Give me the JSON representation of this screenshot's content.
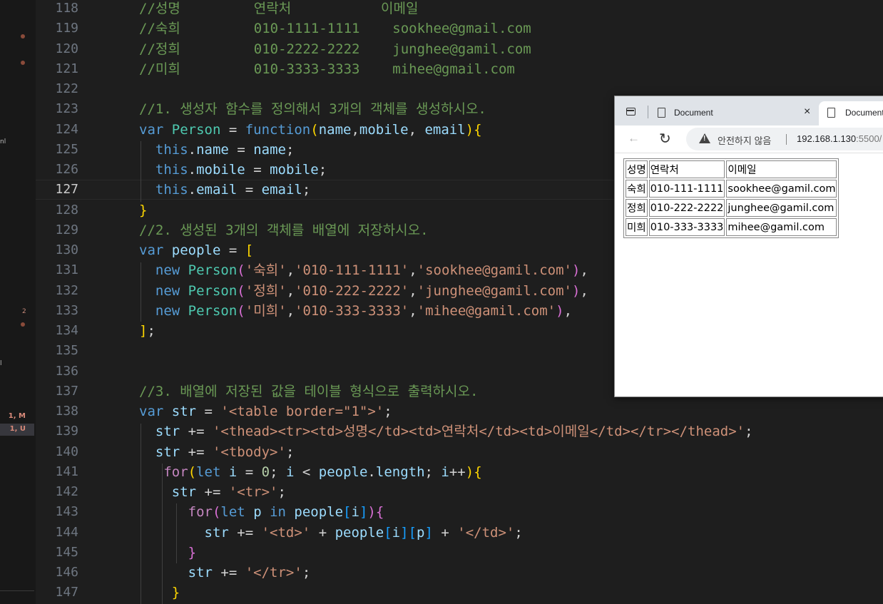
{
  "sidebar": {
    "badges": [
      {
        "label": "2"
      },
      {
        "label": "1, M"
      },
      {
        "label": "1, U"
      },
      {
        "label": "nl"
      },
      {
        "label": "l"
      }
    ]
  },
  "editor": {
    "lines": [
      {
        "n": "118",
        "tokens": [
          [
            "c-com",
            "//성명         연락처           이메일"
          ]
        ]
      },
      {
        "n": "119",
        "tokens": [
          [
            "c-com",
            "//숙희         010-1111-1111    sookhee@gmail.com"
          ]
        ]
      },
      {
        "n": "120",
        "tokens": [
          [
            "c-com",
            "//정희         010-2222-2222    junghee@gamil.com"
          ]
        ]
      },
      {
        "n": "121",
        "tokens": [
          [
            "c-com",
            "//미희         010-3333-3333    mihee@gmail.com"
          ]
        ]
      },
      {
        "n": "122",
        "tokens": []
      },
      {
        "n": "123",
        "tokens": [
          [
            "c-com",
            "//1. 생성자 함수를 정의해서 3개의 객체를 생성하시오."
          ]
        ]
      },
      {
        "n": "124",
        "tokens": [
          [
            "c-kw",
            "var "
          ],
          [
            "c-cls",
            "Person"
          ],
          [
            "",
            " = "
          ],
          [
            "c-kw",
            "function"
          ],
          [
            "c-p1",
            "("
          ],
          [
            "c-var",
            "name"
          ],
          [
            "",
            ","
          ],
          [
            "c-var",
            "mobile"
          ],
          [
            "",
            ", "
          ],
          [
            "c-var",
            "email"
          ],
          [
            "c-p1",
            ")"
          ],
          [
            "c-p1",
            "{"
          ]
        ]
      },
      {
        "n": "125",
        "tokens": [
          [
            "",
            "  "
          ],
          [
            "c-kw",
            "this"
          ],
          [
            "",
            "."
          ],
          [
            "c-var",
            "name"
          ],
          [
            "",
            " = "
          ],
          [
            "c-var",
            "name"
          ],
          [
            "",
            ";"
          ]
        ]
      },
      {
        "n": "126",
        "tokens": [
          [
            "",
            "  "
          ],
          [
            "c-kw",
            "this"
          ],
          [
            "",
            "."
          ],
          [
            "c-var",
            "mobile"
          ],
          [
            "",
            " = "
          ],
          [
            "c-var",
            "mobile"
          ],
          [
            "",
            ";"
          ]
        ]
      },
      {
        "n": "127",
        "tokens": [
          [
            "",
            "  "
          ],
          [
            "c-kw",
            "this"
          ],
          [
            "",
            "."
          ],
          [
            "c-var",
            "email"
          ],
          [
            "",
            " = "
          ],
          [
            "c-var",
            "email"
          ],
          [
            "",
            ";"
          ]
        ]
      },
      {
        "n": "128",
        "tokens": [
          [
            "c-p1",
            "}"
          ]
        ]
      },
      {
        "n": "129",
        "tokens": [
          [
            "c-com",
            "//2. 생성된 3개의 객체를 배열에 저장하시오."
          ]
        ]
      },
      {
        "n": "130",
        "tokens": [
          [
            "c-kw",
            "var "
          ],
          [
            "c-var",
            "people"
          ],
          [
            "",
            " = "
          ],
          [
            "c-p1",
            "["
          ]
        ]
      },
      {
        "n": "131",
        "tokens": [
          [
            "",
            "  "
          ],
          [
            "c-kw",
            "new "
          ],
          [
            "c-cls",
            "Person"
          ],
          [
            "c-p2",
            "("
          ],
          [
            "c-str",
            "'숙희'"
          ],
          [
            "",
            ","
          ],
          [
            "c-str",
            "'010-111-1111'"
          ],
          [
            "",
            ","
          ],
          [
            "c-str",
            "'sookhee@gamil.com'"
          ],
          [
            "c-p2",
            ")"
          ],
          [
            "",
            ","
          ]
        ]
      },
      {
        "n": "132",
        "tokens": [
          [
            "",
            "  "
          ],
          [
            "c-kw",
            "new "
          ],
          [
            "c-cls",
            "Person"
          ],
          [
            "c-p2",
            "("
          ],
          [
            "c-str",
            "'정희'"
          ],
          [
            "",
            ","
          ],
          [
            "c-str",
            "'010-222-2222'"
          ],
          [
            "",
            ","
          ],
          [
            "c-str",
            "'junghee@gamil.com'"
          ],
          [
            "c-p2",
            ")"
          ],
          [
            "",
            ","
          ]
        ]
      },
      {
        "n": "133",
        "tokens": [
          [
            "",
            "  "
          ],
          [
            "c-kw",
            "new "
          ],
          [
            "c-cls",
            "Person"
          ],
          [
            "c-p2",
            "("
          ],
          [
            "c-str",
            "'미희'"
          ],
          [
            "",
            ","
          ],
          [
            "c-str",
            "'010-333-3333'"
          ],
          [
            "",
            ","
          ],
          [
            "c-str",
            "'mihee@gamil.com'"
          ],
          [
            "c-p2",
            ")"
          ],
          [
            "",
            ","
          ]
        ]
      },
      {
        "n": "134",
        "tokens": [
          [
            "c-p1",
            "]"
          ],
          [
            "",
            ";"
          ]
        ]
      },
      {
        "n": "135",
        "tokens": []
      },
      {
        "n": "136",
        "tokens": []
      },
      {
        "n": "137",
        "tokens": [
          [
            "c-com",
            "//3. 배열에 저장된 값을 테이블 형식으로 출력하시오."
          ]
        ]
      },
      {
        "n": "138",
        "tokens": [
          [
            "c-kw",
            "var "
          ],
          [
            "c-var",
            "str"
          ],
          [
            "",
            " = "
          ],
          [
            "c-str",
            "'<table border=\"1\">'"
          ],
          [
            "",
            ";"
          ]
        ]
      },
      {
        "n": "139",
        "tokens": [
          [
            "",
            "  "
          ],
          [
            "c-var",
            "str"
          ],
          [
            "",
            " += "
          ],
          [
            "c-str",
            "'<thead><tr><td>성명</td><td>연락처</td><td>이메일</td></tr></thead>'"
          ],
          [
            "",
            ";"
          ]
        ]
      },
      {
        "n": "140",
        "tokens": [
          [
            "",
            "  "
          ],
          [
            "c-var",
            "str"
          ],
          [
            "",
            " += "
          ],
          [
            "c-str",
            "'<tbody>'"
          ],
          [
            "",
            ";"
          ]
        ]
      },
      {
        "n": "141",
        "tokens": [
          [
            "",
            "   "
          ],
          [
            "c-ctl",
            "for"
          ],
          [
            "c-p1",
            "("
          ],
          [
            "c-kw",
            "let "
          ],
          [
            "c-var",
            "i"
          ],
          [
            "",
            " = "
          ],
          [
            "c-num",
            "0"
          ],
          [
            "",
            "; "
          ],
          [
            "c-var",
            "i"
          ],
          [
            "",
            " < "
          ],
          [
            "c-var",
            "people"
          ],
          [
            "",
            "."
          ],
          [
            "c-var",
            "length"
          ],
          [
            "",
            "; "
          ],
          [
            "c-var",
            "i"
          ],
          [
            "",
            "++"
          ],
          [
            "c-p1",
            ")"
          ],
          [
            "c-p1",
            "{"
          ]
        ]
      },
      {
        "n": "142",
        "tokens": [
          [
            "",
            "    "
          ],
          [
            "c-var",
            "str"
          ],
          [
            "",
            " += "
          ],
          [
            "c-str",
            "'<tr>'"
          ],
          [
            "",
            ";"
          ]
        ]
      },
      {
        "n": "143",
        "tokens": [
          [
            "",
            "      "
          ],
          [
            "c-ctl",
            "for"
          ],
          [
            "c-p2",
            "("
          ],
          [
            "c-kw",
            "let "
          ],
          [
            "c-var",
            "p"
          ],
          [
            "c-kw",
            " in "
          ],
          [
            "c-var",
            "people"
          ],
          [
            "c-p3",
            "["
          ],
          [
            "c-var",
            "i"
          ],
          [
            "c-p3",
            "]"
          ],
          [
            "c-p2",
            ")"
          ],
          [
            "c-p2",
            "{"
          ]
        ]
      },
      {
        "n": "144",
        "tokens": [
          [
            "",
            "        "
          ],
          [
            "c-var",
            "str"
          ],
          [
            "",
            " += "
          ],
          [
            "c-str",
            "'<td>'"
          ],
          [
            "",
            " + "
          ],
          [
            "c-var",
            "people"
          ],
          [
            "c-p3",
            "["
          ],
          [
            "c-var",
            "i"
          ],
          [
            "c-p3",
            "]"
          ],
          [
            "c-p3",
            "["
          ],
          [
            "c-var",
            "p"
          ],
          [
            "c-p3",
            "]"
          ],
          [
            "",
            " + "
          ],
          [
            "c-str",
            "'</td>'"
          ],
          [
            "",
            ";"
          ]
        ]
      },
      {
        "n": "145",
        "tokens": [
          [
            "",
            "      "
          ],
          [
            "c-p2",
            "}"
          ]
        ]
      },
      {
        "n": "146",
        "tokens": [
          [
            "",
            "      "
          ],
          [
            "c-var",
            "str"
          ],
          [
            "",
            " += "
          ],
          [
            "c-str",
            "'</tr>'"
          ],
          [
            "",
            ";"
          ]
        ]
      },
      {
        "n": "147",
        "tokens": [
          [
            "",
            "    "
          ],
          [
            "c-p1",
            "}"
          ]
        ]
      }
    ]
  },
  "browser": {
    "tab1_title": "Document",
    "tab2_title": "Document",
    "security_label": "안전하지 않음",
    "url_host": "192.168.1.130",
    "url_port": ":5500/",
    "table": [
      [
        "성명",
        "연락처",
        "이메일"
      ],
      [
        "숙희",
        "010-111-1111",
        "sookhee@gamil.com"
      ],
      [
        "정희",
        "010-222-2222",
        "junghee@gamil.com"
      ],
      [
        "미희",
        "010-333-3333",
        "mihee@gamil.com"
      ]
    ]
  }
}
